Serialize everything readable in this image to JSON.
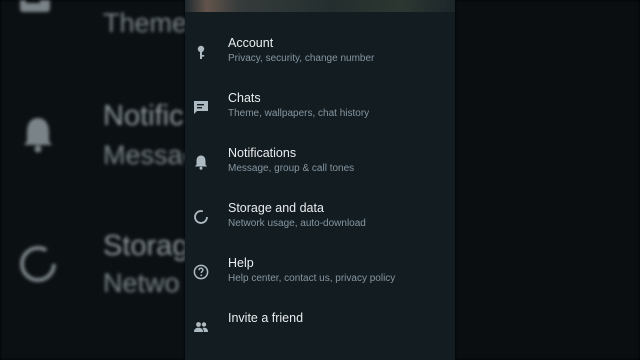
{
  "settings": {
    "items": [
      {
        "title": "Account",
        "subtitle": "Privacy, security, change number",
        "icon": "key-icon"
      },
      {
        "title": "Chats",
        "subtitle": "Theme, wallpapers, chat history",
        "icon": "chat-icon"
      },
      {
        "title": "Notifications",
        "subtitle": "Message, group & call tones",
        "icon": "bell-icon"
      },
      {
        "title": "Storage and data",
        "subtitle": "Network usage, auto-download",
        "icon": "data-usage-icon"
      },
      {
        "title": "Help",
        "subtitle": "Help center, contact us, privacy policy",
        "icon": "help-icon"
      },
      {
        "title": "Invite a friend",
        "subtitle": "",
        "icon": "people-icon"
      }
    ]
  },
  "background": {
    "theme_text": "Theme,",
    "notifications_title": "Notific",
    "notifications_sub": "Messag",
    "storage_title": "Storag",
    "storage_sub": "Netwo"
  },
  "colors": {
    "panel": "#131c21",
    "title_text": "#e9edef",
    "sub_text": "#8696a0",
    "icon": "#aebac1"
  }
}
